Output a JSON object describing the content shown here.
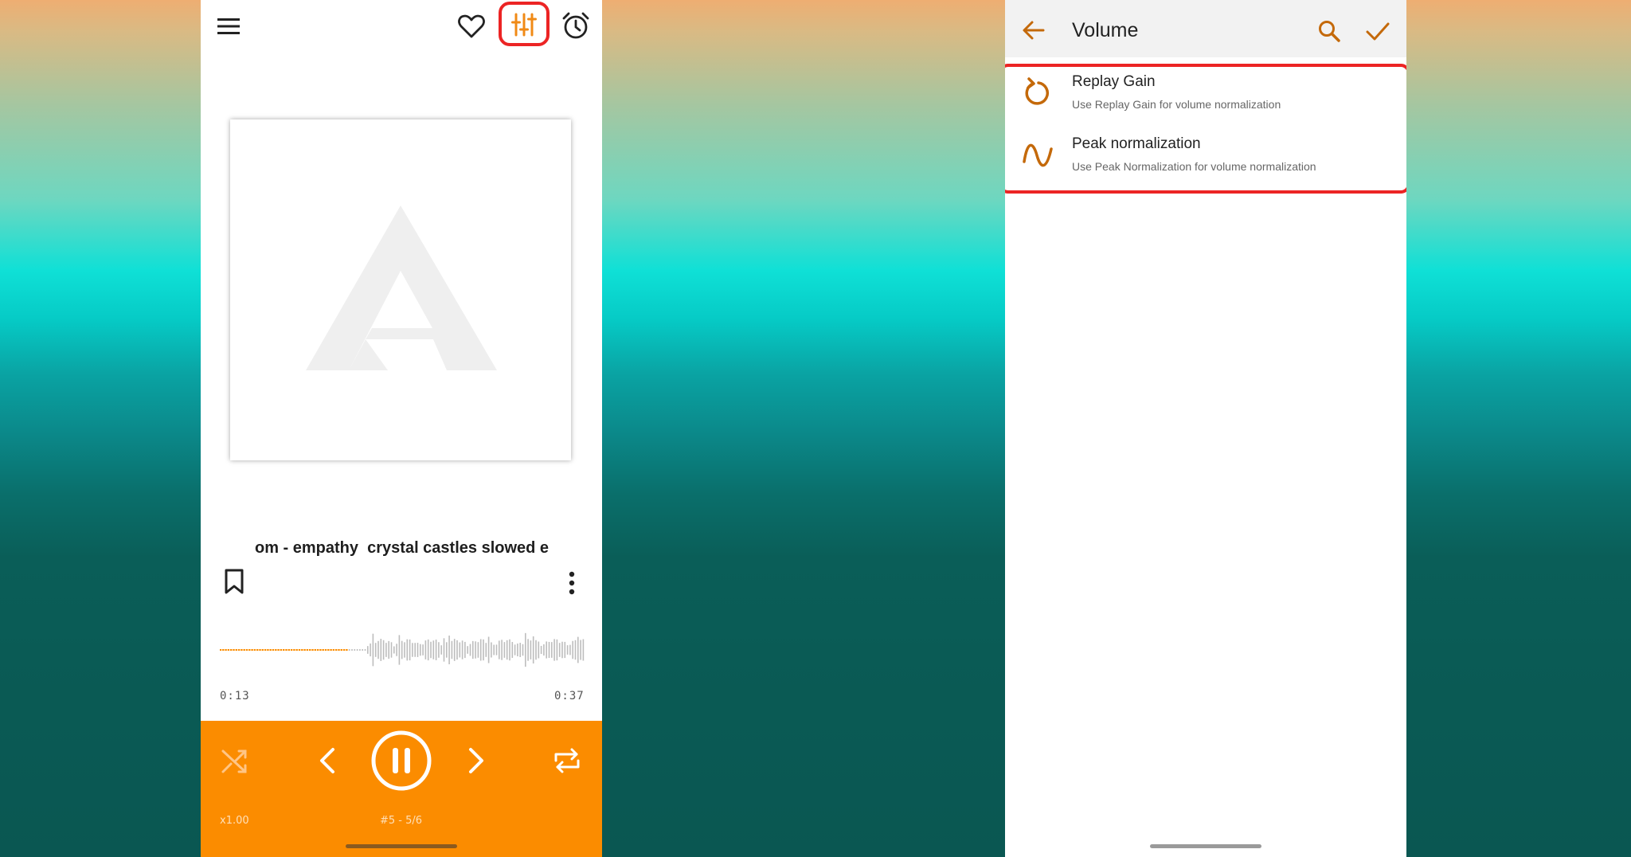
{
  "player": {
    "song_title": "om - empathy  crystal castles slowed e",
    "current_time": "0:13",
    "total_time": "0:37",
    "progress_fraction": 0.35,
    "speed": "x1.00",
    "track_position": "#5 - 5/6",
    "colors": {
      "accent": "#fb8c00",
      "equalizer_icon": "#f08a16",
      "highlight_border": "#ec2424"
    },
    "icons": {
      "menu": "menu-icon",
      "favorite": "heart-icon",
      "equalizer": "equalizer-icon",
      "sleep_timer": "alarm-clock-icon",
      "bookmark": "bookmark-icon",
      "more": "more-vert-icon",
      "shuffle": "shuffle-icon",
      "previous": "chevron-left-icon",
      "play_pause": "pause-icon",
      "next": "chevron-right-icon",
      "repeat": "repeat-icon"
    }
  },
  "volume_screen": {
    "title": "Volume",
    "options": [
      {
        "title": "Replay Gain",
        "subtitle": "Use Replay Gain for volume normalization",
        "icon": "replay-icon"
      },
      {
        "title": "Peak normalization",
        "subtitle": "Use Peak Normalization for volume normalization",
        "icon": "sine-wave-icon"
      }
    ],
    "colors": {
      "accent": "#c4690a"
    },
    "icons": {
      "back": "arrow-left-icon",
      "search": "search-icon",
      "confirm": "check-icon"
    }
  }
}
